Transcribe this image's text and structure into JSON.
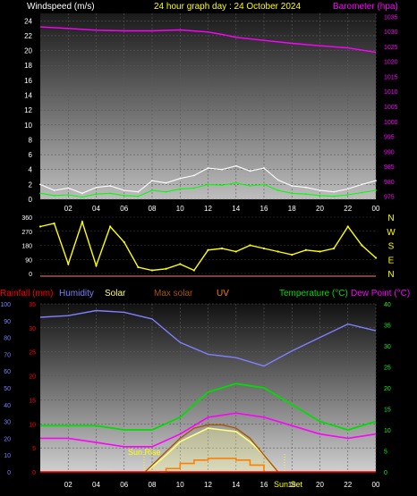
{
  "header": {
    "left": "Windspeed (m/s)",
    "center": "24 hour graph day : 24 October 2024",
    "right": "Barometer (hpa)"
  },
  "colors": {
    "header_left": "#ffffff",
    "header_center": "#ffff00",
    "baro": "#ff00ff",
    "wind": "#ffffff",
    "wind_avg": "#00ff00",
    "direction": "#ffff00",
    "rain": "#ff0000",
    "humidity": "#7f7fff",
    "solar": "#ffff7f",
    "max_solar": "#aa5500",
    "uv": "#ff7f00",
    "temperature": "#00dd00",
    "dew_point": "#ff00ff",
    "tick_left": "#ffffff",
    "tick_right_temp": "#00ff00"
  },
  "lower_legend": {
    "rainfall": "Rainfall (mm)",
    "humidity": "Humidity",
    "solar": "Solar",
    "max_solar": "Max solar",
    "uv": "UV",
    "temperature": "Temperature (°C)",
    "dew_point": "Dew Point (°C)"
  },
  "annotations": {
    "sunrise": "Sun Rise",
    "sunset": "Sun Set"
  },
  "chart_data": [
    {
      "type": "line",
      "title": "Windspeed / Barometer",
      "x_ticks": [
        "02",
        "04",
        "06",
        "08",
        "10",
        "12",
        "14",
        "16",
        "18",
        "20",
        "22",
        "00"
      ],
      "x_range_hours": [
        0,
        24
      ],
      "y_left": {
        "label": "Windspeed (m/s)",
        "range": [
          0,
          25
        ],
        "ticks": [
          "0",
          "2",
          "4",
          "6",
          "8",
          "10",
          "12",
          "14",
          "16",
          "18",
          "20",
          "22",
          "24"
        ]
      },
      "y_right": {
        "label": "Barometer (hpa)",
        "range": [
          974,
          1036
        ],
        "ticks": [
          "975",
          "980",
          "985",
          "990",
          "995",
          "1000",
          "1005",
          "1010",
          "1015",
          "1020",
          "1025",
          "1030",
          "1035"
        ]
      },
      "series": [
        {
          "name": "Barometer",
          "axis": "right",
          "x": [
            0,
            2,
            4,
            6,
            8,
            10,
            12,
            13,
            14,
            16,
            18,
            20,
            22,
            24
          ],
          "values": [
            1031.5,
            1031.0,
            1030.4,
            1030.2,
            1030.2,
            1030.5,
            1029.8,
            1029.0,
            1028.0,
            1027.0,
            1026.0,
            1025.2,
            1024.5,
            1023.0
          ]
        },
        {
          "name": "Wind gust",
          "axis": "left",
          "x": [
            0,
            1,
            2,
            3,
            4,
            5,
            6,
            7,
            8,
            9,
            10,
            11,
            12,
            13,
            14,
            15,
            16,
            17,
            18,
            19,
            20,
            21,
            22,
            23,
            24
          ],
          "values": [
            2.0,
            1.2,
            1.5,
            0.8,
            1.6,
            1.8,
            1.2,
            1.0,
            2.5,
            2.2,
            2.8,
            3.2,
            4.2,
            4.0,
            4.5,
            3.8,
            4.2,
            2.6,
            1.8,
            1.6,
            1.2,
            1.0,
            1.4,
            2.0,
            2.5
          ]
        },
        {
          "name": "Wind average",
          "axis": "left",
          "x": [
            0,
            1,
            2,
            3,
            4,
            5,
            6,
            7,
            8,
            9,
            10,
            11,
            12,
            13,
            14,
            15,
            16,
            17,
            18,
            19,
            20,
            21,
            22,
            23,
            24
          ],
          "values": [
            0.8,
            0.5,
            0.6,
            0.3,
            0.7,
            0.8,
            0.5,
            0.4,
            1.2,
            1.0,
            1.4,
            1.5,
            2.0,
            1.9,
            2.2,
            1.8,
            2.0,
            1.2,
            0.8,
            0.7,
            0.5,
            0.4,
            0.6,
            0.9,
            1.2
          ]
        }
      ]
    },
    {
      "type": "scatter",
      "title": "Wind direction",
      "y_left": {
        "range": [
          0,
          360
        ],
        "ticks": [
          "0",
          "90",
          "180",
          "270",
          "360"
        ]
      },
      "y_right_labels": [
        "N",
        "W",
        "S",
        "E",
        "N"
      ],
      "series": [
        {
          "name": "Direction",
          "x": [
            0,
            1,
            2,
            3,
            4,
            5,
            6,
            7,
            8,
            9,
            10,
            11,
            12,
            13,
            14,
            15,
            16,
            17,
            18,
            19,
            20,
            21,
            22,
            23,
            24
          ],
          "values": [
            300,
            320,
            60,
            330,
            50,
            300,
            200,
            40,
            20,
            30,
            60,
            20,
            150,
            160,
            140,
            180,
            160,
            140,
            120,
            150,
            140,
            160,
            300,
            180,
            100
          ]
        }
      ]
    },
    {
      "type": "line",
      "title": "Rain / Humidity / Solar / Temperature",
      "x_ticks": [
        "02",
        "04",
        "06",
        "08",
        "10",
        "12",
        "14",
        "16",
        "18",
        "20",
        "22",
        "00"
      ],
      "y_left": {
        "range": [
          0,
          100
        ],
        "ticks": [
          "0",
          "10",
          "20",
          "30",
          "40",
          "50",
          "60",
          "70",
          "80",
          "90",
          "100"
        ]
      },
      "y_left_inner": {
        "label": "Rainfall (mm)",
        "range": [
          0,
          35
        ],
        "ticks": [
          "0",
          "5",
          "10",
          "15",
          "20",
          "25",
          "30",
          "35"
        ]
      },
      "y_right": {
        "label": "Temperature (°C)",
        "range": [
          0,
          40
        ],
        "ticks": [
          "0",
          "5",
          "10",
          "15",
          "20",
          "25",
          "30",
          "35",
          "40"
        ]
      },
      "series": [
        {
          "name": "Humidity",
          "axis": "left",
          "x": [
            0,
            2,
            4,
            6,
            8,
            10,
            12,
            14,
            16,
            18,
            20,
            22,
            24
          ],
          "values": [
            92,
            93,
            96,
            95,
            91,
            77,
            70,
            68,
            63,
            72,
            80,
            88,
            84
          ]
        },
        {
          "name": "Temperature",
          "axis": "right",
          "x": [
            0,
            2,
            4,
            6,
            8,
            10,
            12,
            14,
            16,
            18,
            20,
            22,
            24
          ],
          "values": [
            11,
            11,
            11,
            10,
            10,
            13,
            19,
            21,
            20,
            16,
            12,
            10,
            12
          ]
        },
        {
          "name": "Dew Point",
          "axis": "right",
          "x": [
            0,
            2,
            4,
            6,
            8,
            10,
            12,
            14,
            16,
            18,
            20,
            22,
            24
          ],
          "values": [
            8,
            8,
            7,
            6,
            6,
            9,
            13,
            14,
            13,
            11,
            9,
            8,
            9
          ]
        },
        {
          "name": "Solar",
          "axis": "left",
          "x": [
            7.5,
            8,
            9,
            10,
            11,
            12,
            13,
            14,
            15,
            16,
            17
          ],
          "values": [
            0,
            3,
            10,
            18,
            22,
            26,
            25,
            24,
            18,
            10,
            0
          ]
        },
        {
          "name": "Max solar",
          "axis": "left",
          "x": [
            7.5,
            8,
            9,
            10,
            11,
            12,
            13,
            14,
            15,
            16,
            17
          ],
          "values": [
            0,
            4,
            12,
            20,
            26,
            28,
            28,
            26,
            20,
            10,
            0
          ]
        },
        {
          "name": "UV",
          "axis": "left",
          "x": [
            8.5,
            9,
            10,
            11,
            12,
            13,
            14,
            15,
            16
          ],
          "values": [
            0,
            2,
            5,
            7,
            8,
            8,
            7,
            4,
            0
          ]
        },
        {
          "name": "Rainfall",
          "axis": "left_inner",
          "x": [
            0,
            24
          ],
          "values": [
            0,
            0
          ]
        }
      ]
    }
  ]
}
